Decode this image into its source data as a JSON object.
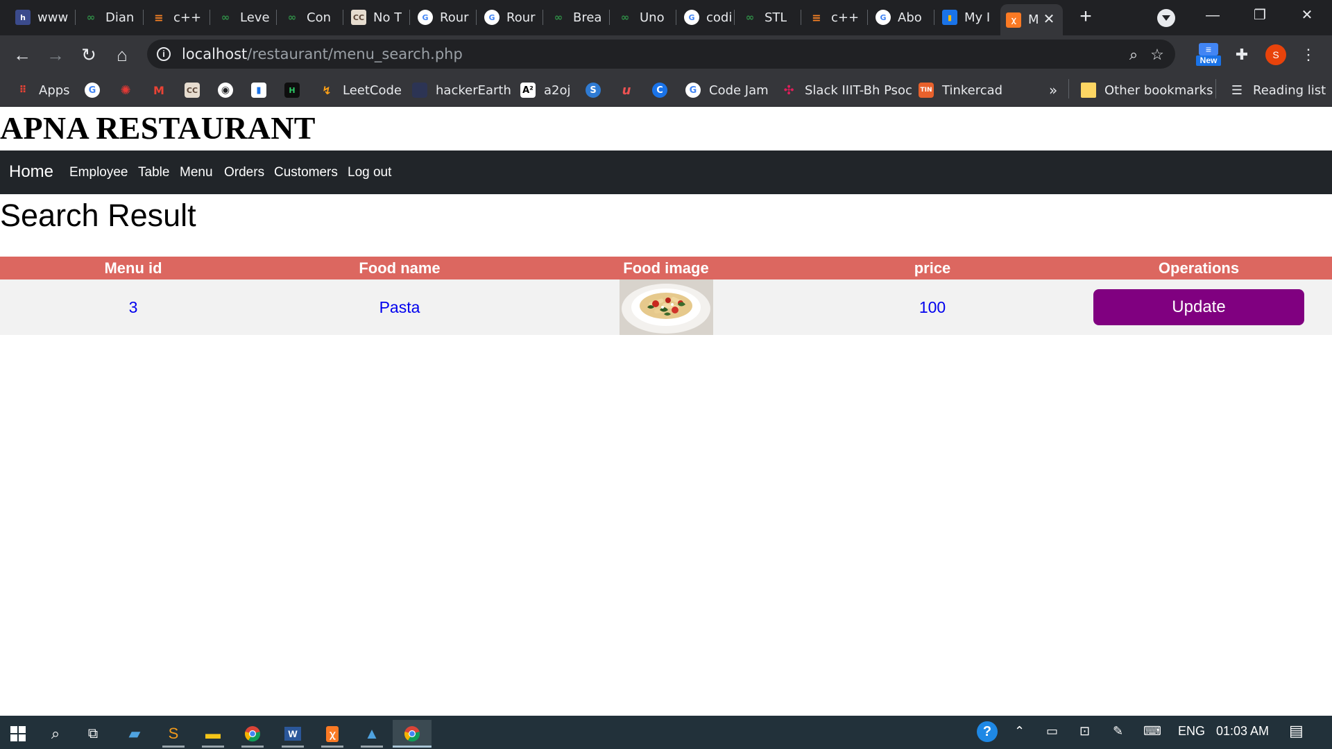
{
  "browser": {
    "tabs": [
      {
        "label": "www",
        "icon": "h-icon"
      },
      {
        "label": "Dian",
        "icon": "gfg-icon"
      },
      {
        "label": "c++",
        "icon": "stackoverflow-icon"
      },
      {
        "label": "Leve",
        "icon": "gfg-icon"
      },
      {
        "label": "Con",
        "icon": "gfg-icon"
      },
      {
        "label": "No T",
        "icon": "codechef-icon"
      },
      {
        "label": "Rour",
        "icon": "google-icon"
      },
      {
        "label": "Rour",
        "icon": "google-icon"
      },
      {
        "label": "Brea",
        "icon": "gfg-icon"
      },
      {
        "label": "Uno",
        "icon": "gfg-icon"
      },
      {
        "label": "codi",
        "icon": "google-icon"
      },
      {
        "label": "STL",
        "icon": "gfg-icon"
      },
      {
        "label": "c++",
        "icon": "stackoverflow-icon"
      },
      {
        "label": "Abo",
        "icon": "google-icon"
      },
      {
        "label": "My I",
        "icon": "chart-icon"
      },
      {
        "label": "M",
        "icon": "xampp-icon",
        "active": true
      }
    ],
    "url_host": "localhost",
    "url_path": "/restaurant/menu_search.php",
    "extension_badge": "New",
    "profile_initial": "S",
    "bookmarks": [
      {
        "label": "Apps",
        "icon": "apps-grid-icon"
      },
      {
        "label": "",
        "icon": "google-icon"
      },
      {
        "label": "",
        "icon": "codechef-bug-icon"
      },
      {
        "label": "",
        "icon": "gmail-icon"
      },
      {
        "label": "",
        "icon": "codechef-icon"
      },
      {
        "label": "",
        "icon": "github-icon"
      },
      {
        "label": "",
        "icon": "chart-icon"
      },
      {
        "label": "",
        "icon": "hackerrank-icon"
      },
      {
        "label": "LeetCode",
        "icon": "leetcode-icon"
      },
      {
        "label": "hackerEarth",
        "icon": "hackerearth-icon"
      },
      {
        "label": "a2oj",
        "icon": "a2oj-icon"
      },
      {
        "label": "",
        "icon": "s-icon"
      },
      {
        "label": "",
        "icon": "udemy-icon"
      },
      {
        "label": "",
        "icon": "codeforces-icon"
      },
      {
        "label": "Code Jam",
        "icon": "google-icon"
      },
      {
        "label": "Slack IIIT-Bh Psoc",
        "icon": "slack-icon"
      },
      {
        "label": "Tinkercad",
        "icon": "tinkercad-icon"
      }
    ],
    "more_bookmarks": "»",
    "other_bookmarks": "Other bookmarks",
    "reading_list": "Reading list"
  },
  "page": {
    "brand": "APNA RESTAURANT",
    "nav": {
      "home": "Home",
      "links": [
        "Employee",
        "Table",
        "Menu",
        "Orders",
        "Customers",
        "Log out"
      ]
    },
    "title": "Search Result",
    "table": {
      "headers": [
        "Menu id",
        "Food name",
        "Food image",
        "price",
        "Operations"
      ],
      "rows": [
        {
          "menu_id": "3",
          "food_name": "Pasta",
          "price": "100",
          "operation": "Update"
        }
      ]
    }
  },
  "colors": {
    "navbar_bg": "#212529",
    "table_header_bg": "#dc6760",
    "row_bg": "#f2f2f2",
    "link_text": "#0000ee",
    "update_button": "#800080"
  },
  "taskbar": {
    "language": "ENG",
    "time": "01:03 AM"
  }
}
